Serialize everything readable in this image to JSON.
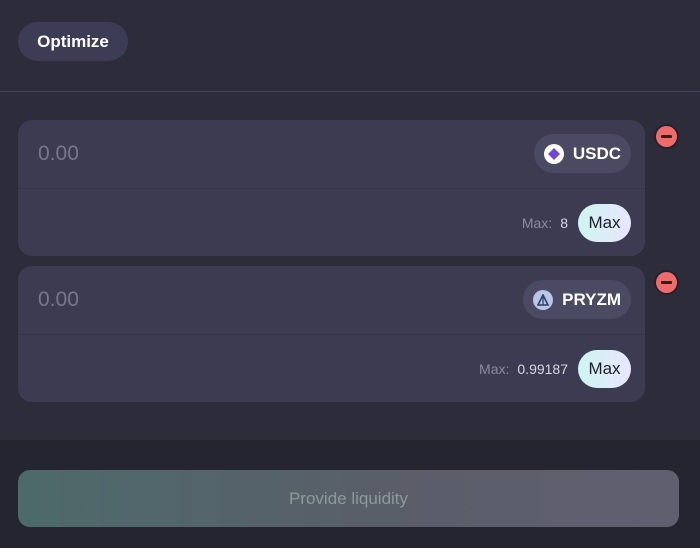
{
  "toolbar": {
    "optimize_label": "Optimize"
  },
  "tokens": [
    {
      "amount_placeholder": "0.00",
      "symbol": "USDC",
      "icon": "usdc-icon",
      "max_label": "Max:",
      "max_value": "8",
      "max_button": "Max"
    },
    {
      "amount_placeholder": "0.00",
      "symbol": "PRYZM",
      "icon": "pryzm-icon",
      "max_label": "Max:",
      "max_value": "0.99187",
      "max_button": "Max"
    }
  ],
  "actions": {
    "provide_label": "Provide liquidity"
  },
  "colors": {
    "remove": "#ef6b6b",
    "usdc": "#6c47d9",
    "pryzm": "#2b3f6b"
  }
}
